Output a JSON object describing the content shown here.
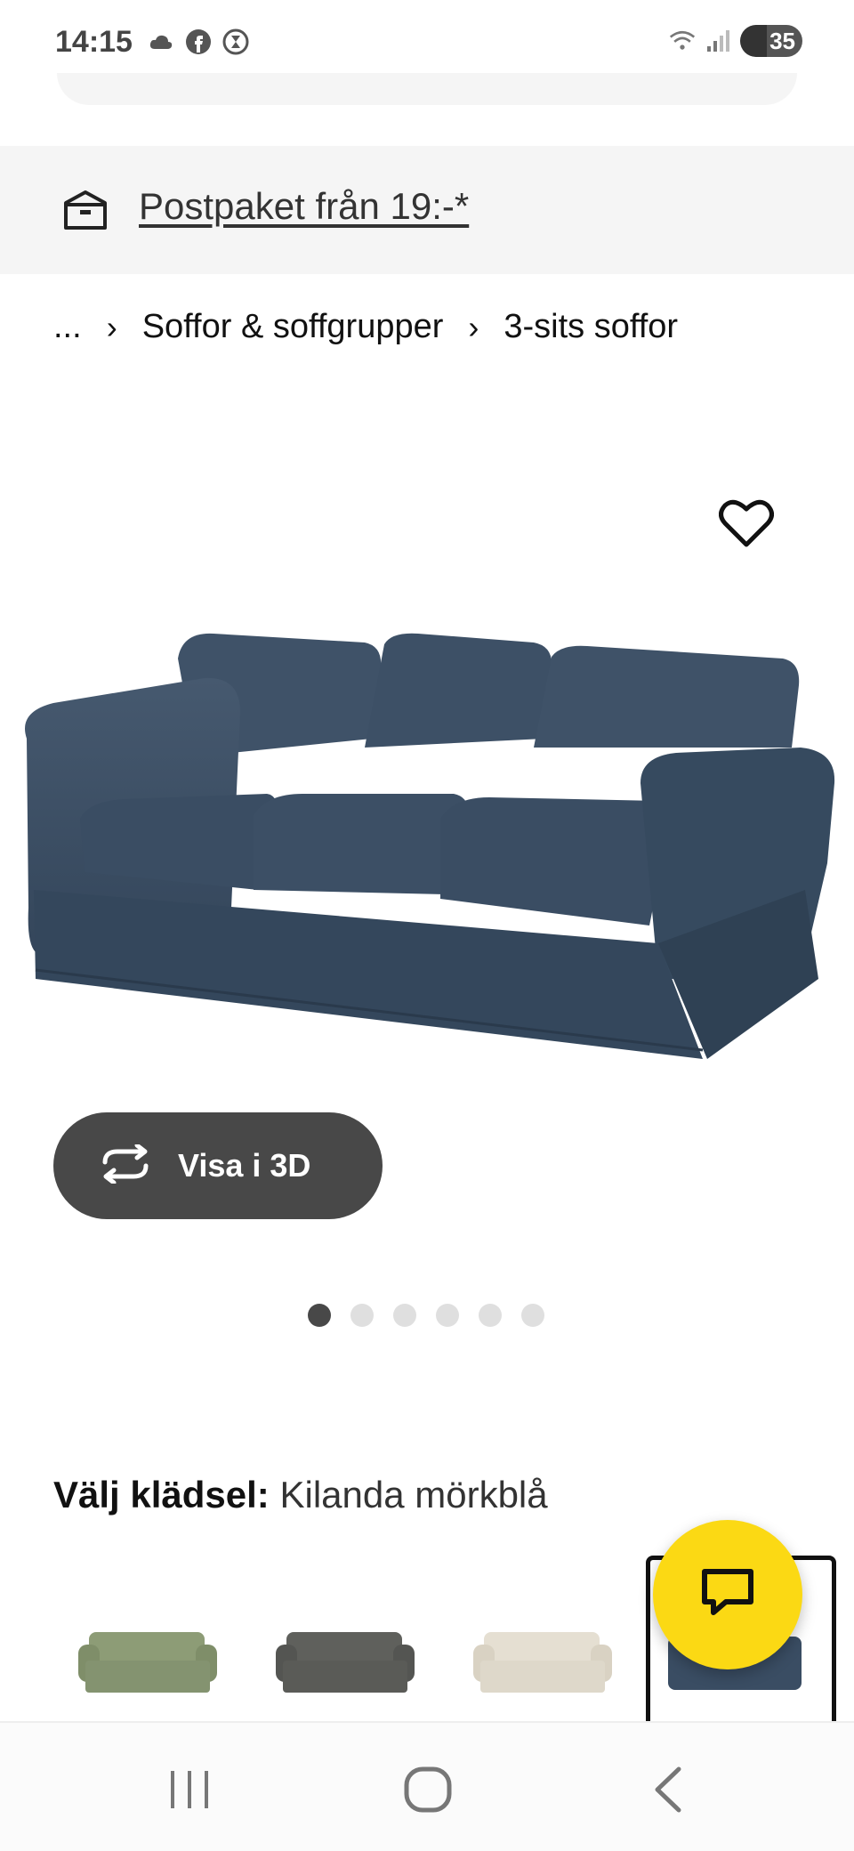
{
  "status_bar": {
    "time": "14:15",
    "battery": "35",
    "icons_left": [
      "cloud-icon",
      "facebook-icon",
      "hourglass-icon"
    ],
    "icons_right": [
      "wifi-icon",
      "signal-icon",
      "battery-icon"
    ]
  },
  "promo": {
    "icon": "delivery-box-icon",
    "text": "Postpaket från 19:-*"
  },
  "breadcrumb": {
    "items": [
      "...",
      "Soffor & soffgrupper",
      "3-sits soffor"
    ]
  },
  "product": {
    "view3d_label": "Visa i 3D",
    "image_count": 6,
    "active_image": 1
  },
  "fabric": {
    "label": "Välj klädsel:",
    "selected": "Kilanda mörkblå",
    "swatches": [
      {
        "color": "#8d9c76"
      },
      {
        "color": "#5f605c"
      },
      {
        "color": "#e5dfd2"
      },
      {
        "color": "#3a4d63"
      }
    ]
  },
  "colors": {
    "sofa": "#3c4e64",
    "chat_button": "#fbd914",
    "button_dark": "#484848"
  }
}
